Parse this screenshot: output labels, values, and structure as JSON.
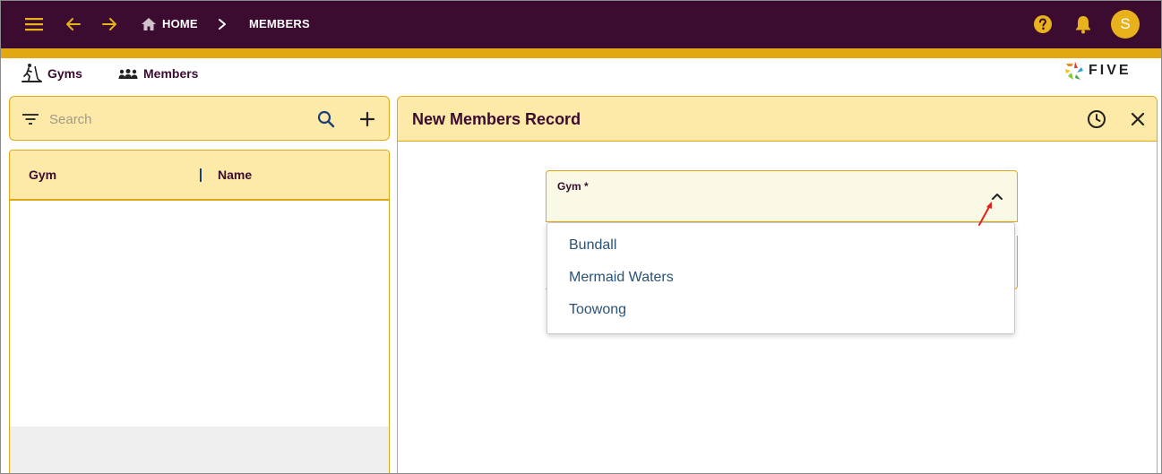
{
  "topbar": {
    "breadcrumb_home": "HOME",
    "breadcrumb_separator": ">",
    "breadcrumb_current": "MEMBERS",
    "avatar_initial": "S",
    "icons": [
      "menu-icon",
      "back-arrow-icon",
      "forward-arrow-icon",
      "home-icon",
      "chevron-right-icon",
      "help-icon",
      "bell-icon"
    ]
  },
  "menu": {
    "items": [
      {
        "label": "Gyms",
        "icon": "treadmill-icon"
      },
      {
        "label": "Members",
        "icon": "people-icon"
      }
    ],
    "logo_text": "FIVE"
  },
  "list": {
    "search_placeholder": "Search",
    "columns": [
      "Gym",
      "Name"
    ],
    "rows": []
  },
  "record": {
    "title": "New Members Record",
    "gym_field_label": "Gym *",
    "gym_value": "",
    "gym_options": [
      "Bundall",
      "Mermaid Waters",
      "Toowong"
    ]
  },
  "colors": {
    "primary": "#3c0b30",
    "accent": "#e2a813",
    "panel_header": "#fde9a8",
    "field_background": "#f9f9e6",
    "option_text": "#2a5276",
    "annotation_arrow": "#e0201c"
  }
}
